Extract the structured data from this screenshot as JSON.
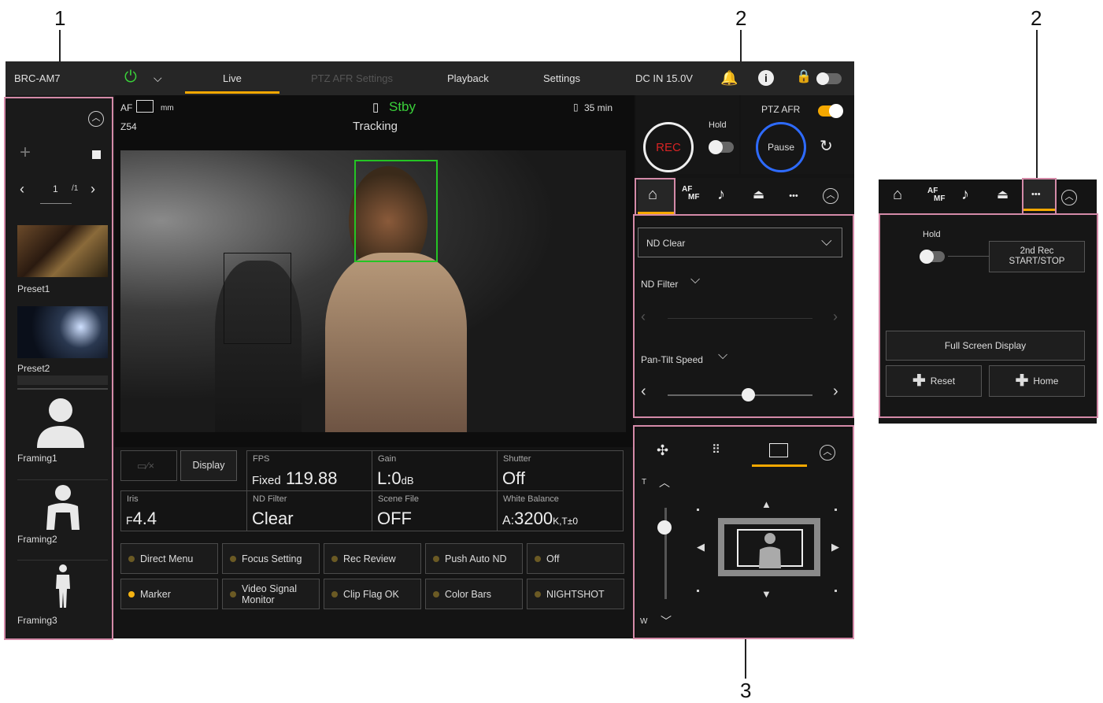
{
  "callouts": [
    "1",
    "2",
    "2",
    "3"
  ],
  "topbar": {
    "model": "BRC-AM7",
    "tabs": [
      "Live",
      "PTZ AFR Settings",
      "Playback",
      "Settings"
    ],
    "power": "DC IN 15.0V"
  },
  "viewfinder": {
    "af": "AF",
    "unit": "mm",
    "zoom": "Z54",
    "stby": "Stby",
    "mode": "Tracking",
    "remain": "35 min"
  },
  "presets": {
    "page": "1",
    "total": "/1",
    "items": [
      "Preset1",
      "Preset2"
    ],
    "framing": [
      "Framing1",
      "Framing2",
      "Framing3"
    ]
  },
  "status": {
    "display_btn": "Display",
    "cells": [
      {
        "label": "FPS",
        "prefix": "Fixed",
        "value": "119.88"
      },
      {
        "label": "Gain",
        "value": "L:0",
        "unit": "dB"
      },
      {
        "label": "Shutter",
        "value": "Off"
      },
      {
        "label": "Iris",
        "prefix": "F",
        "value": "4.4"
      },
      {
        "label": "ND Filter",
        "value": "Clear"
      },
      {
        "label": "Scene File",
        "value": "OFF"
      },
      {
        "label": "White Balance",
        "prefix": "A:",
        "value": "3200",
        "unit": "K,T±0"
      }
    ]
  },
  "assign": [
    "Direct Menu",
    "Focus Setting",
    "Rec Review",
    "Push Auto ND",
    "Off",
    "Marker",
    "Video Signal Monitor",
    "Clip Flag OK",
    "Color Bars",
    "NIGHTSHOT"
  ],
  "rec": {
    "rec": "REC",
    "hold": "Hold",
    "ptz_afr": "PTZ AFR",
    "pause": "Pause"
  },
  "home_panel": {
    "nd_select": "ND Clear",
    "nd_filter": "ND Filter",
    "pan_tilt": "Pan-Tilt Speed"
  },
  "tabs": {
    "afmf_top": "AF",
    "afmf_bottom": "MF",
    "more": "•••"
  },
  "more_panel": {
    "hold": "Hold",
    "second_rec": "2nd Rec START/STOP",
    "full_screen": "Full Screen Display",
    "reset": "Reset",
    "home": "Home"
  },
  "ptz_panel": {
    "t": "T",
    "w": "W"
  }
}
